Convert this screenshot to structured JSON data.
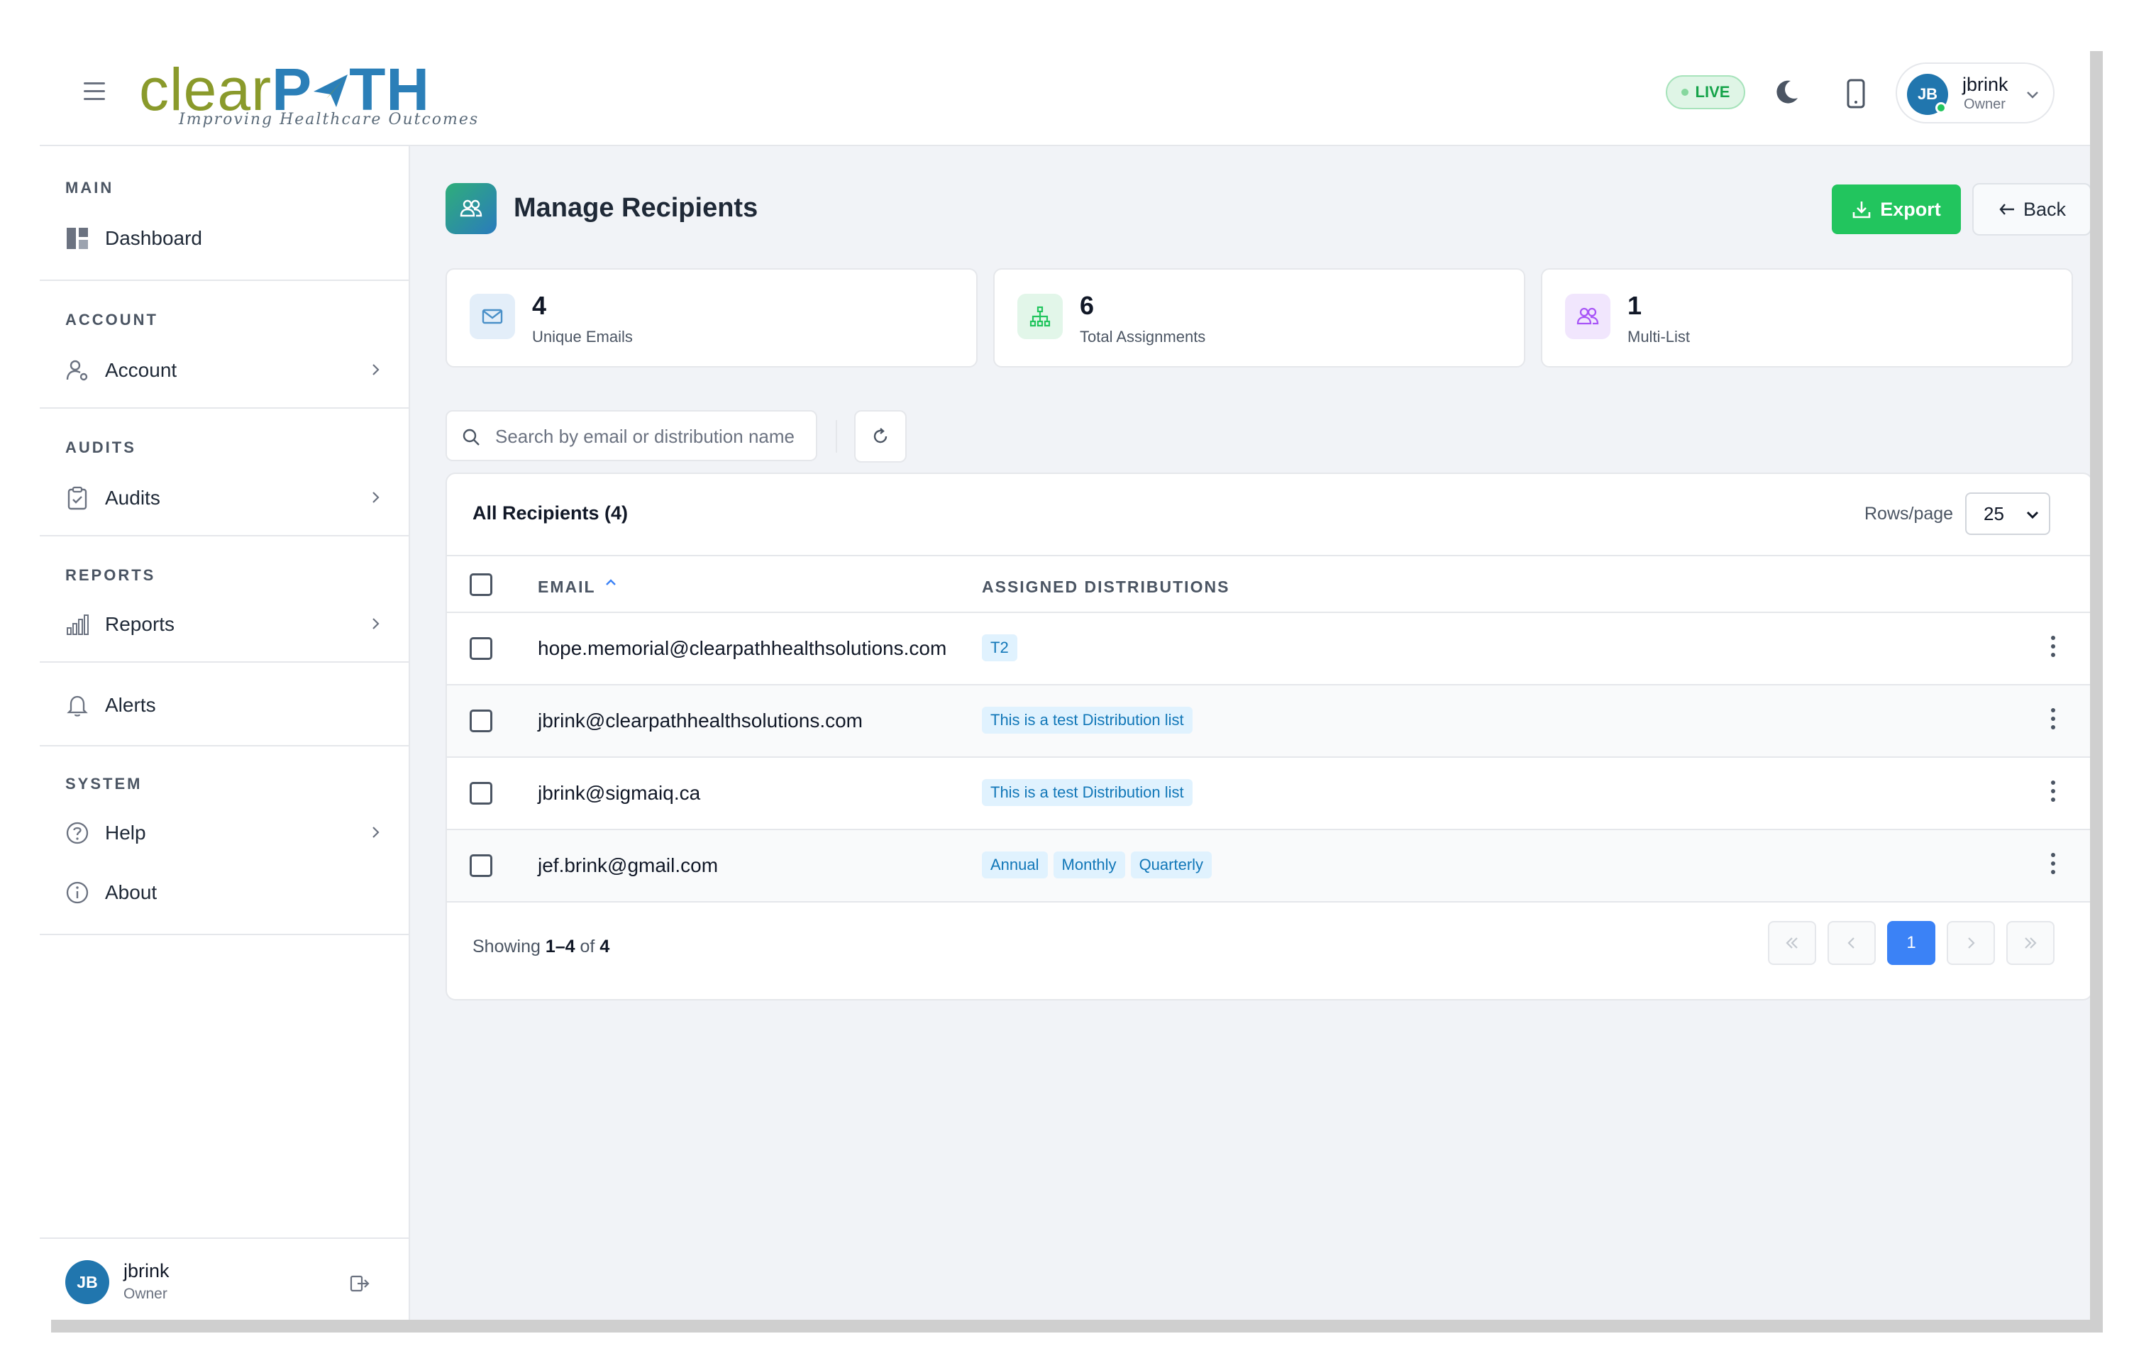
{
  "brand": {
    "logo_left": "clear",
    "logo_p": "P",
    "logo_right": "TH",
    "tagline": "Improving Healthcare Outcomes"
  },
  "header": {
    "status": "LIVE",
    "user": {
      "initials": "JB",
      "name": "jbrink",
      "role": "Owner"
    }
  },
  "sidebar": {
    "sections": [
      {
        "title": "MAIN",
        "items": [
          {
            "label": "Dashboard",
            "icon": "dashboard-icon"
          }
        ]
      },
      {
        "title": "ACCOUNT",
        "items": [
          {
            "label": "Account",
            "icon": "user-gear-icon"
          }
        ]
      },
      {
        "title": "AUDITS",
        "items": [
          {
            "label": "Audits",
            "icon": "clipboard-check-icon"
          }
        ]
      },
      {
        "title": "REPORTS",
        "items": [
          {
            "label": "Reports",
            "icon": "bar-chart-icon"
          }
        ]
      },
      {
        "title": "",
        "items": [
          {
            "label": "Alerts",
            "icon": "bell-icon"
          }
        ]
      },
      {
        "title": "SYSTEM",
        "items": [
          {
            "label": "Help",
            "icon": "question-circle-icon"
          },
          {
            "label": "About",
            "icon": "info-circle-icon"
          }
        ]
      }
    ],
    "user": {
      "initials": "JB",
      "name": "jbrink",
      "role": "Owner"
    }
  },
  "main": {
    "title": "Manage Recipients",
    "export_label": "Export",
    "back_label": "Back",
    "stats": [
      {
        "value": "4",
        "label": "Unique Emails",
        "icon": "envelope-icon",
        "color": "#4a90c8"
      },
      {
        "value": "6",
        "label": "Total Assignments",
        "icon": "hierarchy-icon",
        "color": "#22c55e"
      },
      {
        "value": "1",
        "label": "Multi-List",
        "icon": "users-icon",
        "color": "#a855f7"
      }
    ],
    "search": {
      "placeholder": "Search by email or distribution name",
      "value": ""
    },
    "table": {
      "title": "All Recipients (4)",
      "rows_per_page_label": "Rows/page",
      "rows_per_page": "25",
      "columns": [
        "EMAIL",
        "ASSIGNED DISTRIBUTIONS"
      ],
      "rows": [
        {
          "email": "hope.memorial@clearpathhealthsolutions.com",
          "distributions": [
            "T2"
          ]
        },
        {
          "email": "jbrink@clearpathhealthsolutions.com",
          "distributions": [
            "This is a test Distribution list"
          ]
        },
        {
          "email": "jbrink@sigmaiq.ca",
          "distributions": [
            "This is a test Distribution list"
          ]
        },
        {
          "email": "jef.brink@gmail.com",
          "distributions": [
            "Annual",
            "Monthly",
            "Quarterly"
          ]
        }
      ],
      "footer": {
        "prefix": "Showing",
        "range": "1–4",
        "of_label": "of",
        "total": "4"
      },
      "pagination": {
        "current_page": "1"
      }
    }
  },
  "colors": {
    "accent_green": "#22c55e",
    "accent_blue": "#3b82f6",
    "tag_bg": "#e0f2fe",
    "tag_text": "#1177b8"
  }
}
